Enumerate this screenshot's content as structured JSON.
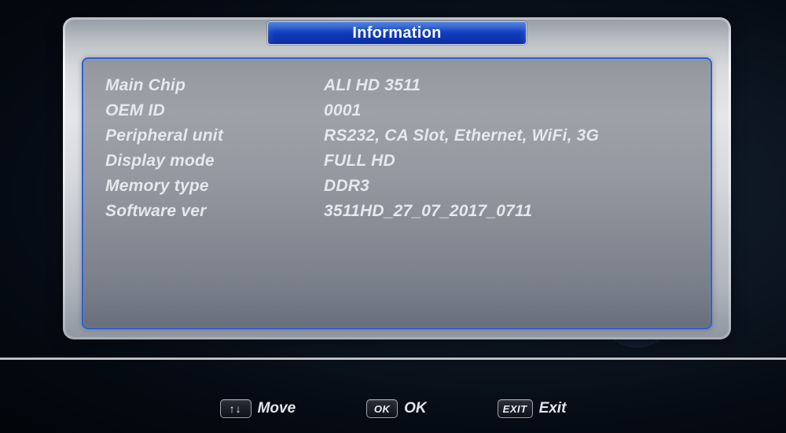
{
  "title": "Information",
  "rows": [
    {
      "label": "Main Chip",
      "value": "ALI HD 3511"
    },
    {
      "label": "OEM ID",
      "value": "0001"
    },
    {
      "label": "Peripheral unit",
      "value": "RS232, CA Slot, Ethernet, WiFi, 3G"
    },
    {
      "label": "Display mode",
      "value": "FULL HD"
    },
    {
      "label": "Memory type",
      "value": "DDR3"
    },
    {
      "label": "Software ver",
      "value": "3511HD_27_07_2017_0711"
    }
  ],
  "hints": {
    "move": {
      "key": "↑↓",
      "label": "Move"
    },
    "ok": {
      "key": "OK",
      "label": "OK"
    },
    "exit": {
      "key": "EXIT",
      "label": "Exit"
    }
  }
}
